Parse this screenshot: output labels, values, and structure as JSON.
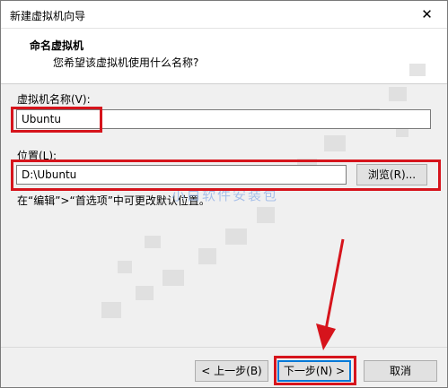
{
  "window": {
    "title": "新建虚拟机向导",
    "close_glyph": "✕"
  },
  "header": {
    "title": "命名虚拟机",
    "subtitle": "您希望该虚拟机使用什么名称?"
  },
  "form": {
    "name_label": "虚拟机名称(V):",
    "name_value": "Ubuntu",
    "location_label": "位置(L):",
    "location_value": "D:\\Ubuntu",
    "browse_label": "浏览(R)...",
    "hint": "在“编辑”>“首选项”中可更改默认位置。"
  },
  "watermark": "小白软件安装包",
  "buttons": {
    "back": "< 上一步(B)",
    "next": "下一步(N) >",
    "cancel": "取消"
  },
  "colors": {
    "highlight": "#d6141c",
    "focus": "#0078d7"
  }
}
